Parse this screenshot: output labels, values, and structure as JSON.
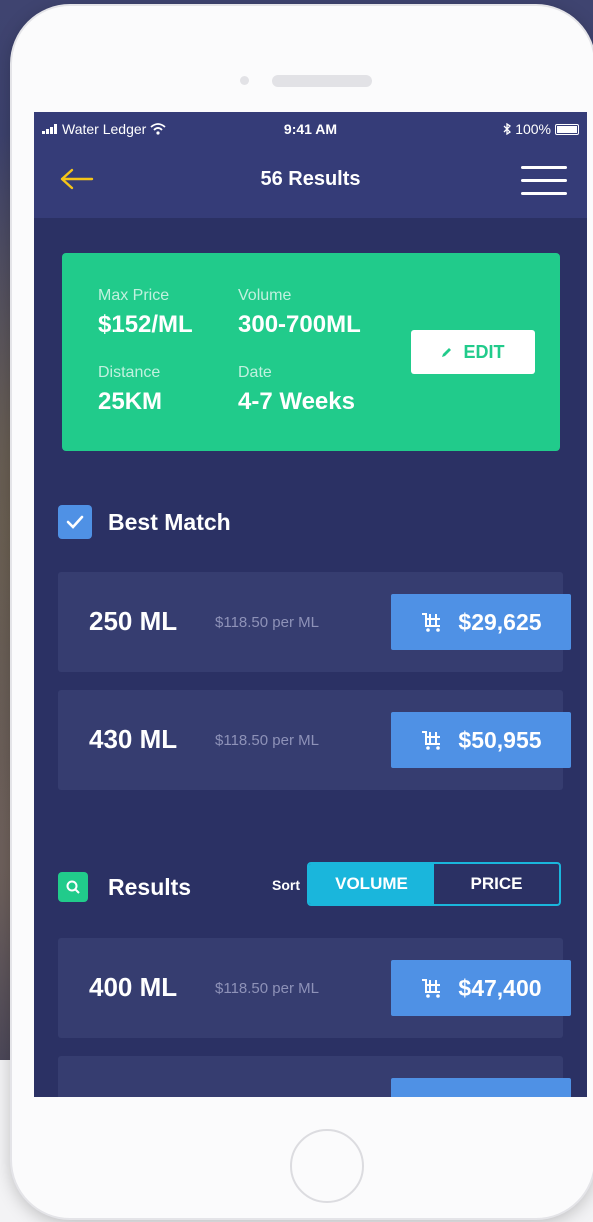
{
  "status_bar": {
    "carrier": "Water Ledger",
    "time": "9:41 AM",
    "battery": "100%"
  },
  "nav": {
    "title": "56 Results",
    "back_icon": "arrow-left-icon",
    "menu_icon": "hamburger-menu-icon"
  },
  "filter": {
    "max_price_label": "Max Price",
    "max_price_value": "$152/ML",
    "volume_label": "Volume",
    "volume_value": "300-700ML",
    "distance_label": "Distance",
    "distance_value": "25KM",
    "date_label": "Date",
    "date_value": "4-7 Weeks",
    "edit_label": "EDIT",
    "edit_icon": "pencil-icon"
  },
  "best_match": {
    "label": "Best Match",
    "checked": true,
    "rows": [
      {
        "volume": "250 ML",
        "rate": "$118.50 per ML",
        "price": "$29,625"
      },
      {
        "volume": "430 ML",
        "rate": "$118.50 per ML",
        "price": "$50,955"
      }
    ]
  },
  "results": {
    "label": "Results",
    "sort_label": "Sort",
    "sort_options": [
      "VOLUME",
      "PRICE"
    ],
    "sort_selected": "VOLUME",
    "rows": [
      {
        "volume": "400 ML",
        "rate": "$118.50 per ML",
        "price": "$47,400"
      }
    ]
  },
  "colors": {
    "screen_bg": "#2b3164",
    "bar_bg": "#353c78",
    "accent_green": "#21cb8b",
    "button_blue": "#4f91e5",
    "toggle_cyan": "#1ab6dc",
    "back_arrow": "#f5c518"
  }
}
